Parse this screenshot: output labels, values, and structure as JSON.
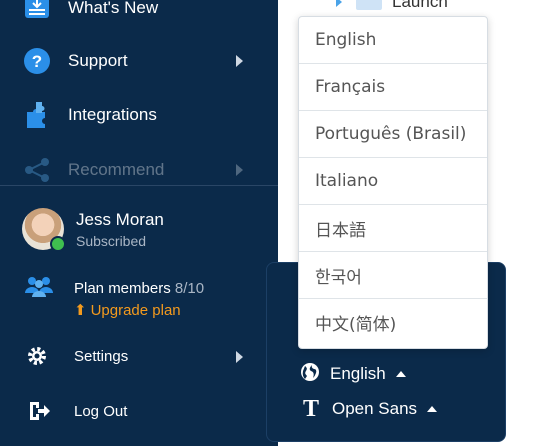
{
  "sidebar": {
    "items": [
      {
        "label": "What's New",
        "icon": "whats-new-icon"
      },
      {
        "label": "Support",
        "icon": "support-icon"
      },
      {
        "label": "Integrations",
        "icon": "integrations-icon"
      },
      {
        "label": "Recommend",
        "icon": "share-icon"
      }
    ],
    "user": {
      "name": "Jess Moran",
      "status": "Subscribed",
      "online": true
    },
    "plan": {
      "label": "Plan members",
      "count": "8/10",
      "upgrade_label": "Upgrade plan"
    },
    "settings_label": "Settings",
    "logout_label": "Log Out"
  },
  "tree": {
    "item_label": "Launch"
  },
  "preferences": {
    "language_label": "English",
    "font_label": "Open Sans"
  },
  "language_menu": {
    "options": [
      "English",
      "Français",
      "Português (Brasil)",
      "Italiano",
      "日本語",
      "한국어",
      "中文(简体)"
    ]
  },
  "colors": {
    "sidebar_bg": "#0b2a4a",
    "accent": "#f39a1e",
    "online": "#3fbf4f",
    "icon_blue": "#2b8fe8"
  }
}
